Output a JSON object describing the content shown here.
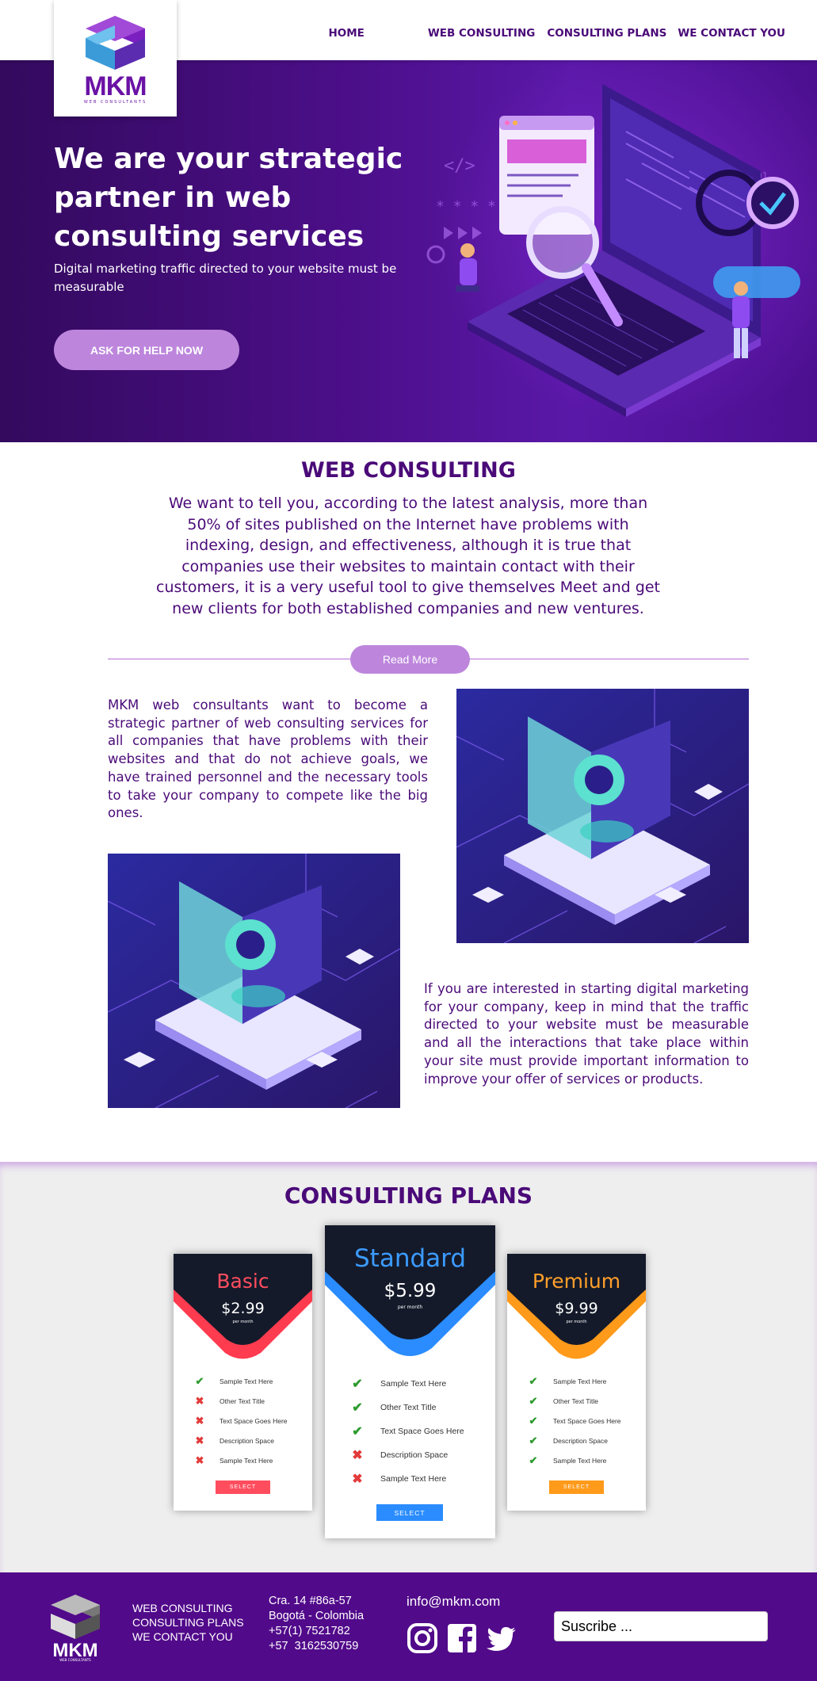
{
  "brand": {
    "logo_text": "MKM",
    "logo_sub": "WEB CONSULTANTS"
  },
  "nav": {
    "home": "HOME",
    "web_consulting": "WEB CONSULTING",
    "consulting_plans": "CONSULTING PLANS",
    "contact": "WE CONTACT YOU"
  },
  "hero": {
    "title": "We are your strategic partner in web consulting services",
    "subtitle": "Digital marketing traffic directed to your website must be measurable",
    "cta": "ASK FOR HELP NOW"
  },
  "web_consulting": {
    "title": "WEB CONSULTING",
    "intro": "We want to tell you, according to the latest analysis, more than 50% of sites published on the Internet have problems with indexing, design, and effectiveness, although it is true that companies use their websites to maintain contact with their customers, it is a very useful tool to give themselves Meet and get new clients for both established companies and new ventures.",
    "read_more": "Read More",
    "paragraph_1": "MKM web consultants want to become a strategic partner of web consulting services for all companies that have problems with their websites and that do not achieve goals, we have trained personnel and the necessary tools to take your company to compete like the big ones.",
    "paragraph_2": "If you are interested in starting digital marketing for your company, keep in mind that the traffic directed to your website must be measurable and all the interactions that take place within your site must provide important information to improve your offer of services or products."
  },
  "plans": {
    "title": "CONSULTING PLANS",
    "cards": [
      {
        "name": "Basic",
        "price": "$2.99",
        "per": "per month",
        "accent": "#ff3b4f",
        "button": "SELECT",
        "features": [
          {
            "text": "Sample Text Here",
            "ok": true
          },
          {
            "text": "Other Text Title",
            "ok": false
          },
          {
            "text": "Text Space Goes Here",
            "ok": false
          },
          {
            "text": "Description Space",
            "ok": false
          },
          {
            "text": "Sample Text Here",
            "ok": false
          }
        ]
      },
      {
        "name": "Standard",
        "price": "$5.99",
        "per": "per month",
        "accent": "#2a8cff",
        "button": "SELECT",
        "features": [
          {
            "text": "Sample Text Here",
            "ok": true
          },
          {
            "text": "Other Text Title",
            "ok": true
          },
          {
            "text": "Text Space Goes Here",
            "ok": true
          },
          {
            "text": "Description Space",
            "ok": false
          },
          {
            "text": "Sample Text Here",
            "ok": false
          }
        ]
      },
      {
        "name": "Premium",
        "price": "$9.99",
        "per": "per month",
        "accent": "#ff9a1a",
        "button": "SELECT",
        "features": [
          {
            "text": "Sample Text Here",
            "ok": true
          },
          {
            "text": "Other Text Title",
            "ok": true
          },
          {
            "text": "Text Space Goes Here",
            "ok": true
          },
          {
            "text": "Description Space",
            "ok": true
          },
          {
            "text": "Sample Text Here",
            "ok": true
          }
        ]
      }
    ]
  },
  "footer": {
    "links": [
      "WEB CONSULTING",
      "CONSULTING PLANS",
      "WE CONTACT YOU"
    ],
    "address": "Cra. 14 #86a-57\nBogotá - Colombia\n+57(1) 7521782\n+57  3162530759",
    "email": "info@mkm.com",
    "social": [
      "instagram-icon",
      "facebook-icon",
      "twitter-icon"
    ],
    "subscribe_placeholder": "Suscribe ..."
  },
  "colors": {
    "brand_purple": "#4a0a78",
    "hero_bg": "#4a0e86",
    "button_lilac": "#bd86dc",
    "footer_bg": "#510a8a"
  }
}
